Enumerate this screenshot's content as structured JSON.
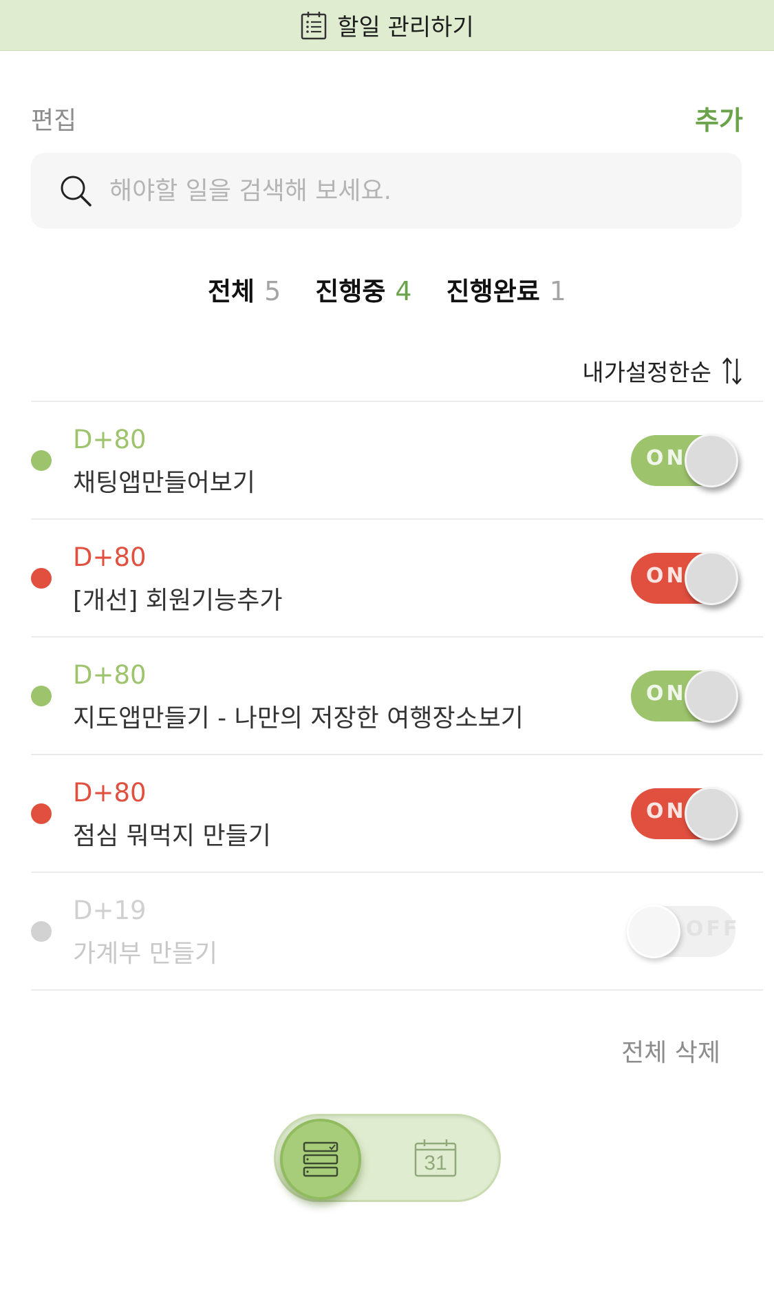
{
  "header": {
    "title": "할일 관리하기",
    "icon": "checklist-icon"
  },
  "actions": {
    "edit_label": "편집",
    "add_label": "추가"
  },
  "search": {
    "placeholder": "해야할 일을 검색해 보세요.",
    "value": ""
  },
  "filters": [
    {
      "label": "전체",
      "count": "5"
    },
    {
      "label": "진행중",
      "count": "4"
    },
    {
      "label": "진행완료",
      "count": "1"
    }
  ],
  "sort": {
    "label": "내가설정한순",
    "icon": "sort-arrows-icon"
  },
  "todos": [
    {
      "dday": "D+80",
      "title": "채팅앱만들어보기",
      "color": "#9dc36c",
      "toggle": "ON",
      "enabled": true
    },
    {
      "dday": "D+80",
      "title": "[개선] 회원기능추가",
      "color": "#e1503f",
      "toggle": "ON",
      "enabled": true
    },
    {
      "dday": "D+80",
      "title": "지도앱만들기 - 나만의 저장한 여행장소보기",
      "color": "#9dc36c",
      "toggle": "ON",
      "enabled": true
    },
    {
      "dday": "D+80",
      "title": "점심 뭐먹지 만들기",
      "color": "#e1503f",
      "toggle": "ON",
      "enabled": true
    },
    {
      "dday": "D+19",
      "title": "가계부 만들기",
      "color": "#d2d2d2",
      "toggle": "OFF",
      "enabled": false
    }
  ],
  "footer": {
    "delete_all_label": "전체 삭제"
  },
  "view_switch": {
    "active": "list",
    "list_icon": "list-view-icon",
    "calendar_icon": "calendar-icon",
    "calendar_day": "31"
  },
  "colors": {
    "accent": "#6aa34a",
    "header_bg": "#e0ecd0",
    "green": "#9dc36c",
    "red": "#e1503f",
    "disabled": "#d2d2d2"
  }
}
